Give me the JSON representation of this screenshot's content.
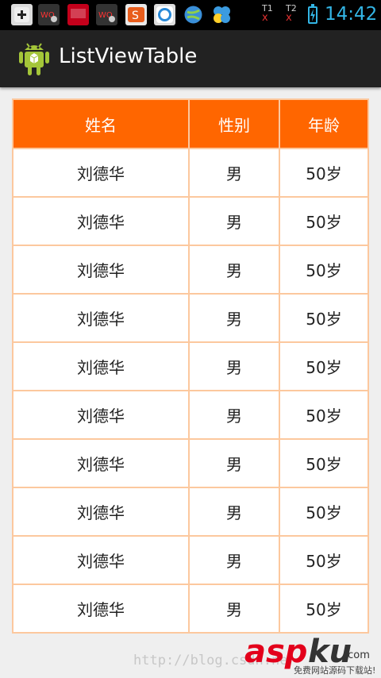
{
  "status_bar": {
    "time": "14:42",
    "sim1_label": "T1",
    "sim2_label": "T2",
    "no_signal_mark": "x",
    "notification_icons": [
      "add-icon",
      "wo-app-icon",
      "netease-icon",
      "wo-app-icon",
      "shop-icon",
      "store-icon",
      "globe-icon",
      "pinwheel-icon"
    ]
  },
  "action_bar": {
    "title": "ListViewTable"
  },
  "table": {
    "headers": [
      "姓名",
      "性别",
      "年龄"
    ],
    "rows": [
      [
        "刘德华",
        "男",
        "50岁"
      ],
      [
        "刘德华",
        "男",
        "50岁"
      ],
      [
        "刘德华",
        "男",
        "50岁"
      ],
      [
        "刘德华",
        "男",
        "50岁"
      ],
      [
        "刘德华",
        "男",
        "50岁"
      ],
      [
        "刘德华",
        "男",
        "50岁"
      ],
      [
        "刘德华",
        "男",
        "50岁"
      ],
      [
        "刘德华",
        "男",
        "50岁"
      ],
      [
        "刘德华",
        "男",
        "50岁"
      ],
      [
        "刘德华",
        "男",
        "50岁"
      ]
    ],
    "header_color": "#ff6600",
    "border_color": "#fcc89e"
  },
  "watermark": {
    "url_text": "http://blog.csdn.ne",
    "logo_asp": "asp",
    "logo_ku": "ku",
    "logo_com": ".com",
    "logo_tagline": "免费网站源码下载站!"
  }
}
